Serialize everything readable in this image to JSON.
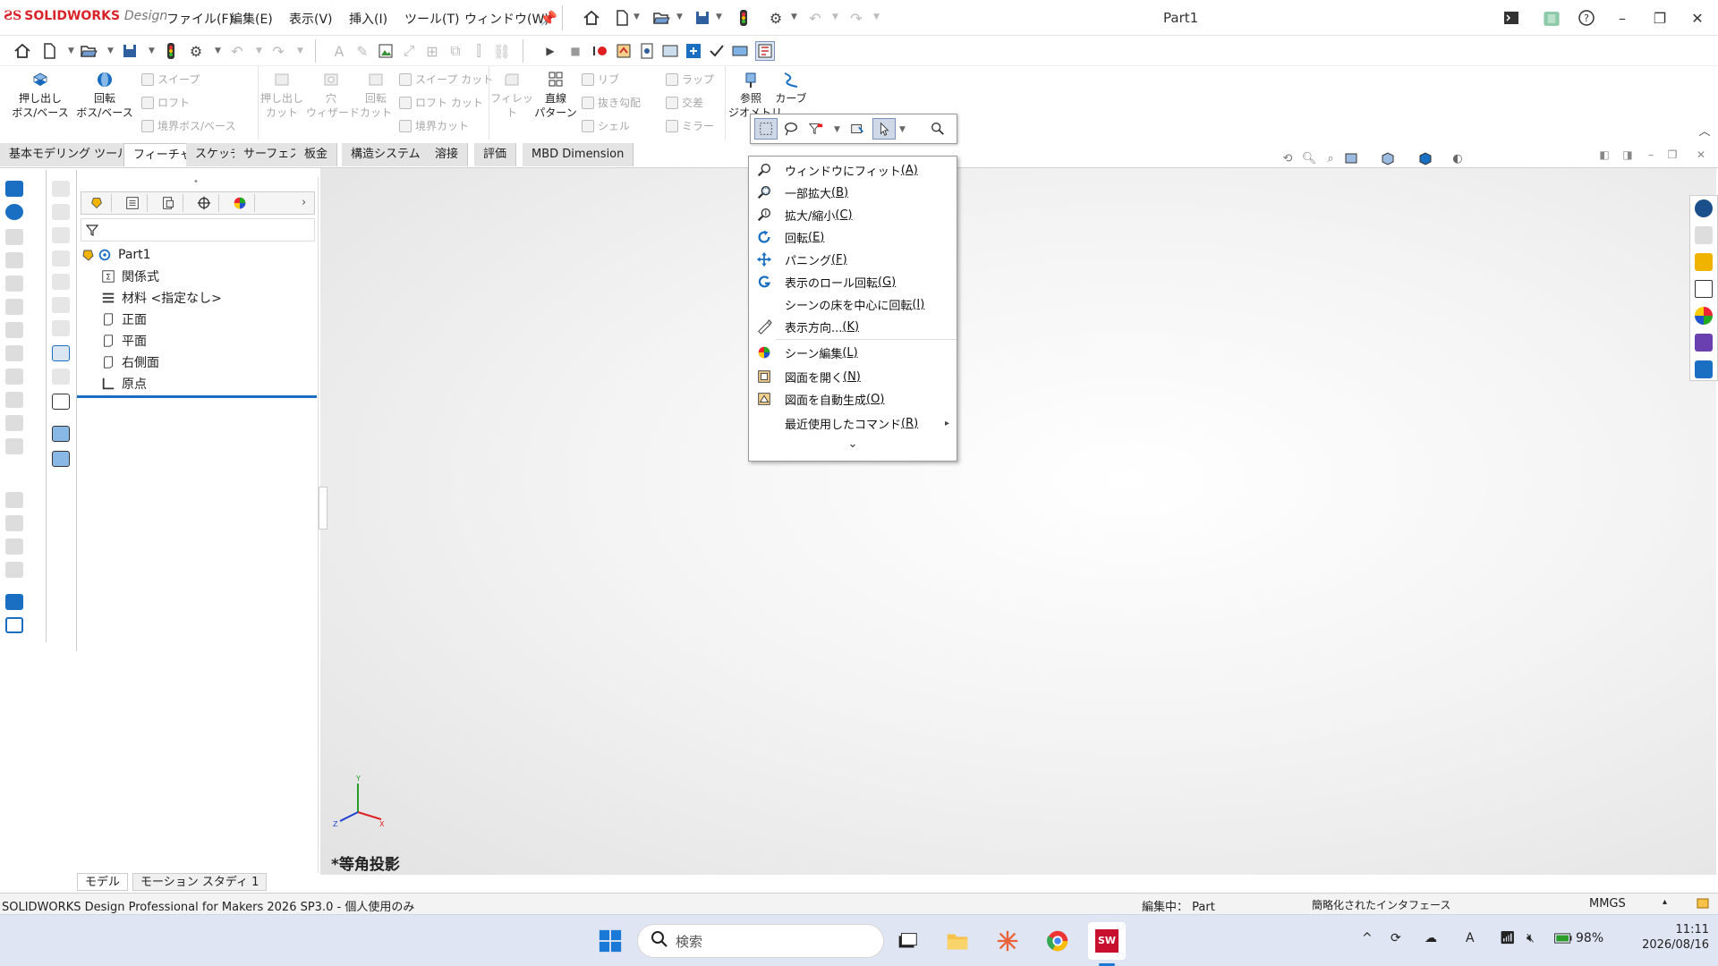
{
  "app": {
    "logo_brand": "SOLIDWORKS",
    "logo_suffix": "Design",
    "document_title": "Part1"
  },
  "menus": [
    "ファイル(F)",
    "編集(E)",
    "表示(V)",
    "挿入(I)",
    "ツール(T)",
    "ウィンドウ(W)"
  ],
  "ribbon": {
    "extrude_boss": "押し出し\nボス/ベース",
    "revolve_boss": "回転\nボス/ベース",
    "sweep": "スイープ",
    "loft": "ロフト",
    "boundary_boss": "境界ボス/ベース",
    "extrude_cut": "押し出し\nカット",
    "hole_wizard": "穴\nウィザード",
    "revolve_cut": "回転\nカット",
    "sweep_cut": "スイープ カット",
    "loft_cut": "ロフト カット",
    "boundary_cut": "境界カット",
    "fillet": "フィレット",
    "linear_pattern": "直線\nパターン",
    "rib": "リブ",
    "draft": "抜き勾配",
    "shell": "シェル",
    "wrap": "ラップ",
    "intersect": "交差",
    "mirror": "ミラー",
    "reference_geometry": "参照\nジオメトリ",
    "curves": "カーブ"
  },
  "tabs": [
    "基本モデリング ツール",
    "フィーチャー",
    "スケッチ",
    "サーフェス",
    "板金",
    "構造システム",
    "溶接",
    "評価",
    "MBD Dimension"
  ],
  "active_tab": "フィーチャー",
  "feature_tree": {
    "root": "Part1",
    "items": [
      {
        "label": "関係式",
        "icon": "equations-icon"
      },
      {
        "label": "材料 <指定なし>",
        "icon": "material-icon"
      },
      {
        "label": "正面",
        "icon": "plane-icon"
      },
      {
        "label": "平面",
        "icon": "plane-icon"
      },
      {
        "label": "右側面",
        "icon": "plane-icon"
      },
      {
        "label": "原点",
        "icon": "origin-icon"
      }
    ]
  },
  "bottom_tabs": [
    "モデル",
    "モーション スタディ 1"
  ],
  "view_label": "*等角投影",
  "context_menu": {
    "items": [
      {
        "text": "ウィンドウにフィット ",
        "key": "(A)",
        "icon": "zoom-fit-icon"
      },
      {
        "text": "一部拡大 ",
        "key": "(B)",
        "icon": "zoom-area-icon"
      },
      {
        "text": "拡大/縮小 ",
        "key": "(C)",
        "icon": "zoom-in-out-icon"
      },
      {
        "text": "回転 ",
        "key": "(E)",
        "icon": "rotate-icon"
      },
      {
        "text": "パニング ",
        "key": "(F)",
        "icon": "pan-icon"
      },
      {
        "text": "表示のロール回転 ",
        "key": "(G)",
        "icon": "roll-view-icon"
      },
      {
        "text": "シーンの床を中心に回転 ",
        "key": "(I)",
        "icon": ""
      },
      {
        "text": "表示方向... ",
        "key": "(K)",
        "icon": "view-orientation-icon"
      },
      {
        "text": "シーン編集 ",
        "key": "(L)",
        "icon": "edit-scene-icon"
      },
      {
        "text": "図面を開く ",
        "key": "(N)",
        "icon": "open-drawing-icon"
      },
      {
        "text": "図面を自動生成 ",
        "key": "(O)",
        "icon": "auto-drawing-icon"
      },
      {
        "text": "最近使用したコマンド ",
        "key": "(R)",
        "icon": ""
      }
    ],
    "expand_glyph": "⌄"
  },
  "status": {
    "product": "SOLIDWORKS Design Professional for Makers 2026 SP3.0 - 個人使用のみ",
    "editing": "編集中： Part",
    "interface": "簡略化されたインタフェース",
    "units": "MMGS"
  },
  "taskbar": {
    "search_placeholder": "検索",
    "battery": "98%",
    "time": "11:11",
    "date": "2026/08/16"
  },
  "colors": {
    "brand_red": "#d8232a",
    "accent_blue": "#1a6fc2",
    "sw_taskbar_red": "#c8102e"
  }
}
